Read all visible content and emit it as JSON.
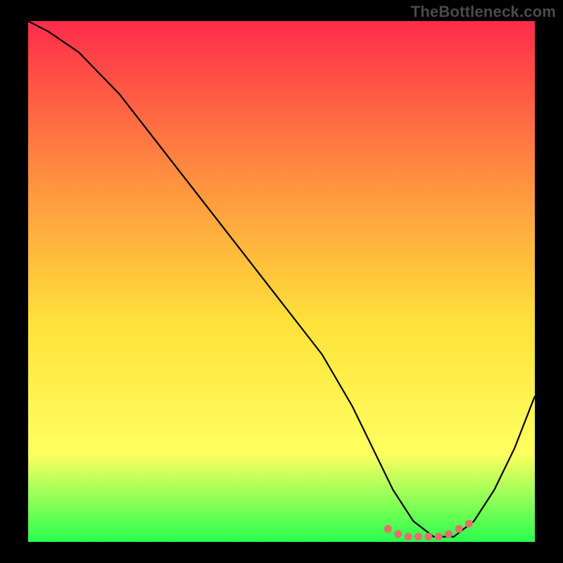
{
  "watermark": "TheBottleneck.com",
  "colors": {
    "background": "#000000",
    "gradient_top": "#ff2c4a",
    "gradient_mid1": "#ff8f3f",
    "gradient_mid2": "#ffe23a",
    "gradient_mid3": "#ffff60",
    "gradient_bottom": "#28ff4f",
    "curve": "#000000",
    "marker": "#e76d6d"
  },
  "chart_data": {
    "type": "line",
    "title": "",
    "xlabel": "",
    "ylabel": "",
    "xlim": [
      0,
      100
    ],
    "ylim": [
      0,
      100
    ],
    "grid": false,
    "series": [
      {
        "name": "bottleneck-curve",
        "x": [
          0,
          4,
          10,
          18,
          26,
          34,
          42,
          50,
          58,
          64,
          68,
          72,
          76,
          80,
          84,
          88,
          92,
          96,
          100
        ],
        "y": [
          100,
          98,
          94,
          86,
          76,
          66,
          56,
          46,
          36,
          26,
          18,
          10,
          4,
          1,
          1,
          4,
          10,
          18,
          28
        ]
      }
    ],
    "markers": {
      "name": "highlight-band",
      "x": [
        71,
        73,
        75,
        77,
        79,
        81,
        83,
        85,
        87
      ],
      "y": [
        2.5,
        1.5,
        1,
        1,
        1,
        1,
        1.5,
        2.5,
        3.5
      ]
    },
    "annotations": []
  }
}
